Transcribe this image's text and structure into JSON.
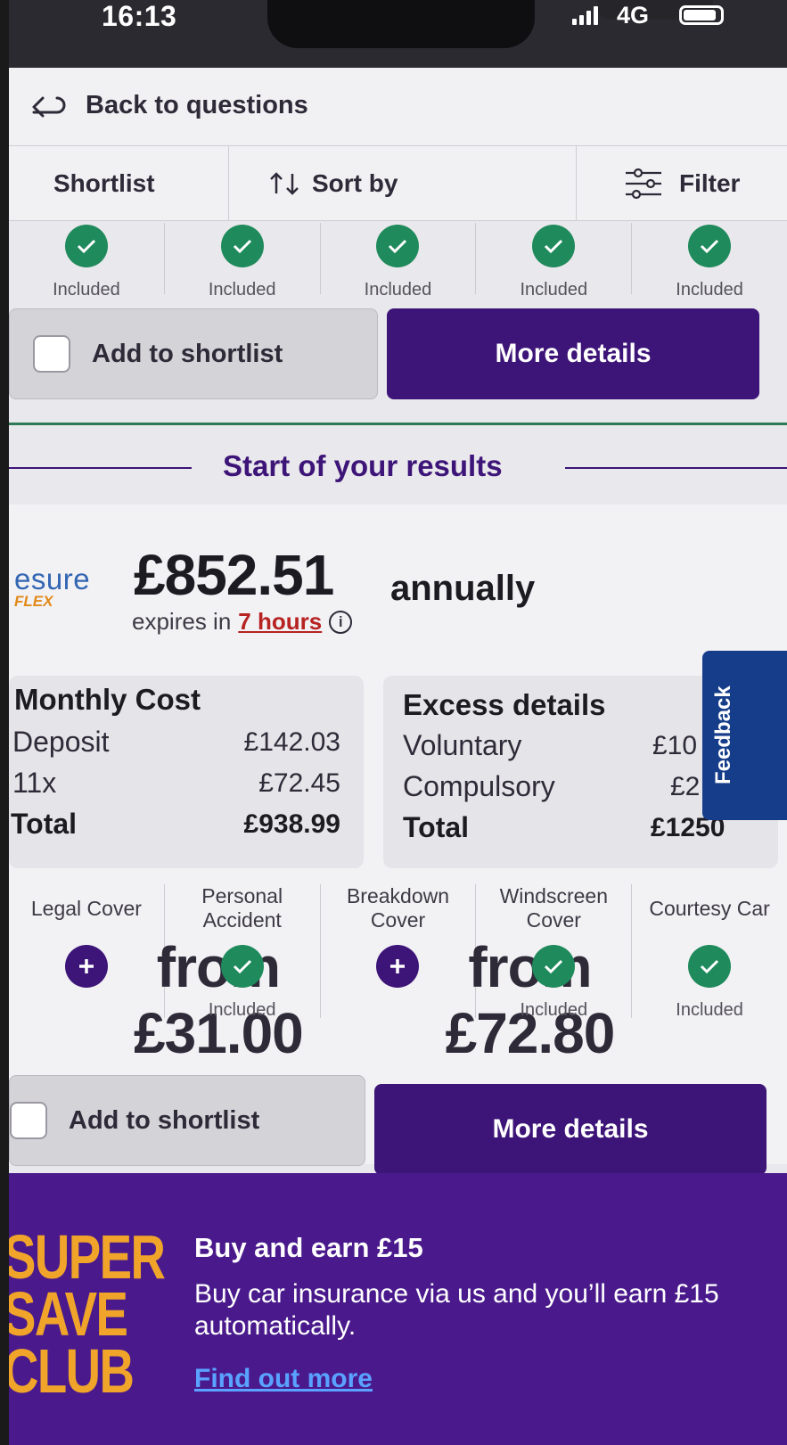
{
  "status_bar": {
    "time": "16:13",
    "network": "4G"
  },
  "nav": {
    "back_label": "Back to questions"
  },
  "toolbar": {
    "shortlist": "Shortlist",
    "sort": "Sort by",
    "filter": "Filter"
  },
  "prev_card": {
    "coverage": [
      {
        "status": "Included"
      },
      {
        "status": "Included"
      },
      {
        "status": "Included"
      },
      {
        "status": "Included"
      },
      {
        "status": "Included"
      }
    ],
    "shortlist_label": "Add to shortlist",
    "details_label": "More details"
  },
  "results_header": "Start of your results",
  "quote": {
    "provider": "esure",
    "provider_sub": "FLEX",
    "price": "£852.51",
    "period": "annually",
    "expires_prefix": "expires in",
    "expires_time": "7 hours",
    "monthly": {
      "title": "Monthly Cost",
      "rows": [
        {
          "label": "Deposit",
          "value": "£142.03"
        },
        {
          "label": "11x",
          "value": "£72.45"
        },
        {
          "label": "Total",
          "value": "£938.99"
        }
      ]
    },
    "excess": {
      "title": "Excess details",
      "rows": [
        {
          "label": "Voluntary",
          "value": "£10"
        },
        {
          "label": "Compulsory",
          "value": "£2"
        },
        {
          "label": "Total",
          "value": "£1250"
        }
      ]
    },
    "coverage": [
      {
        "name": "Legal Cover",
        "status": "from £31.00",
        "included": false
      },
      {
        "name": "Personal Accident",
        "status": "Included",
        "included": true
      },
      {
        "name": "Breakdown Cover",
        "status": "from £72.80",
        "included": false
      },
      {
        "name": "Windscreen Cover",
        "status": "Included",
        "included": true
      },
      {
        "name": "Courtesy Car",
        "status": "Included",
        "included": true
      }
    ],
    "shortlist_label": "Add to shortlist",
    "details_label": "More details"
  },
  "feedback_label": "Feedback",
  "promo": {
    "logo_lines": [
      "SUPER",
      "SAVE",
      "CLUB"
    ],
    "title": "Buy and earn £15",
    "body": "Buy car insurance via us and you’ll earn £15 automatically.",
    "link": "Find out more"
  },
  "colors": {
    "brand_purple": "#3d1478",
    "included_green": "#1f8a5b",
    "expiry_red": "#b72222",
    "promo_bg": "#4a1a8c"
  }
}
